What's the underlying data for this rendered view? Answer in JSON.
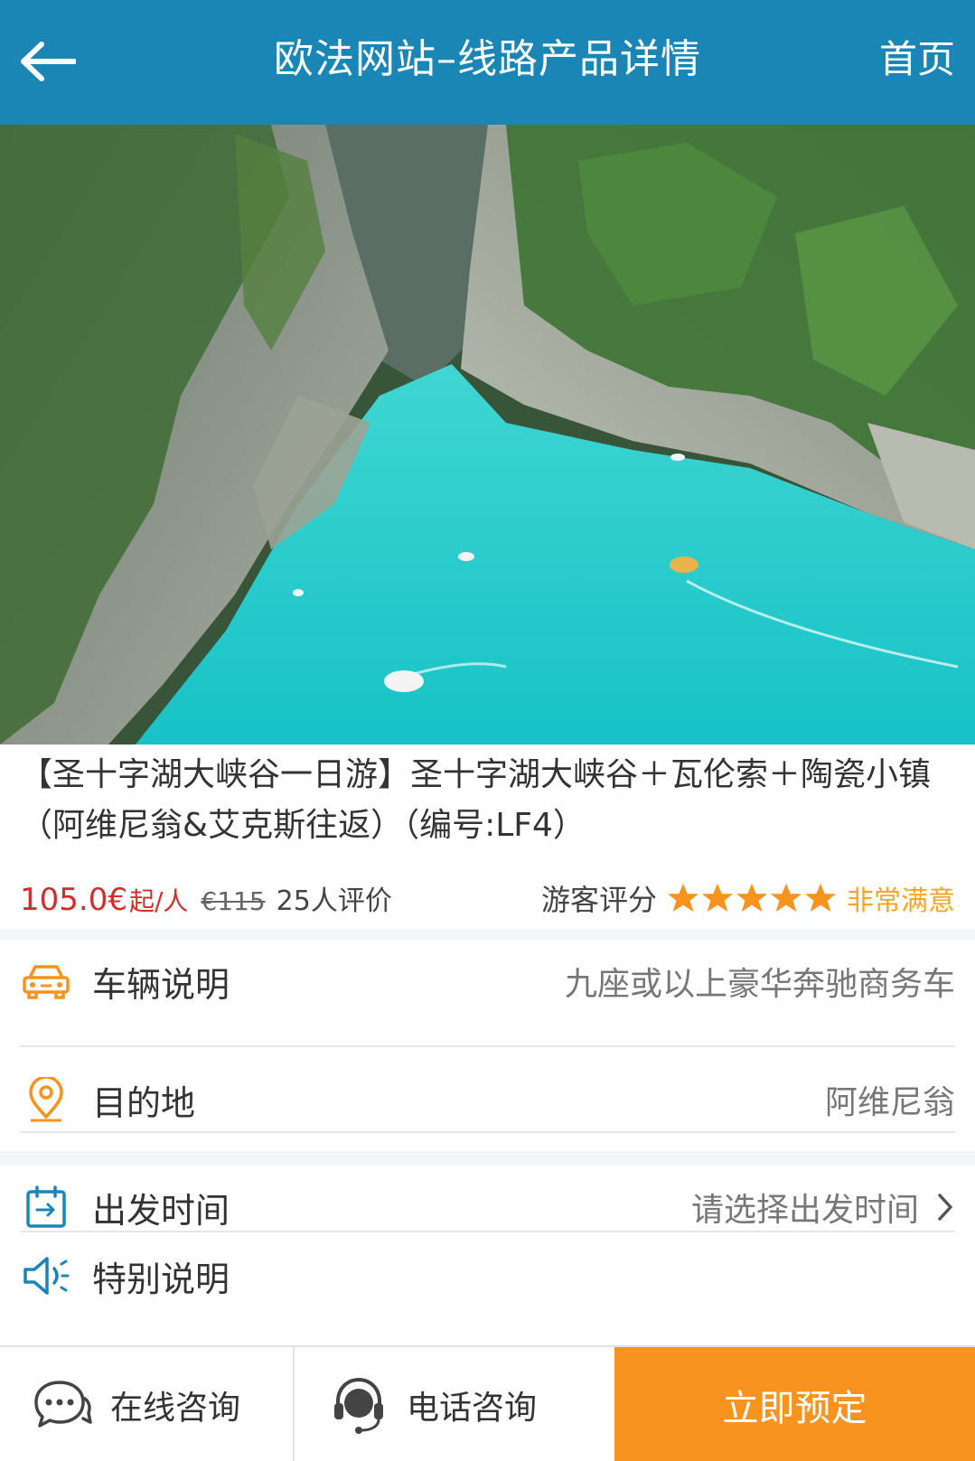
{
  "header": {
    "title": "欧法网站–线路产品详情",
    "home_label": "首页"
  },
  "product": {
    "title": "【圣十字湖大峡谷一日游】圣十字湖大峡谷＋瓦伦索＋陶瓷小镇（阿维尼翁&艾克斯往返）（编号:LF4）",
    "price": "105.0€",
    "price_unit": "起/人",
    "old_price": "€115",
    "review_count": "25人评价",
    "rating_label": "游客评分",
    "rating_stars": 5,
    "rating_text": "非常满意"
  },
  "info": {
    "vehicle": {
      "label": "车辆说明",
      "value": "九座或以上豪华奔驰商务车",
      "icon": "car-icon"
    },
    "destination": {
      "label": "目的地",
      "value": "阿维尼翁",
      "icon": "location-pin-icon"
    }
  },
  "options": {
    "departure": {
      "label": "出发时间",
      "value": "请选择出发时间",
      "icon": "calendar-icon"
    },
    "notes": {
      "label": "特别说明",
      "icon": "speaker-icon"
    }
  },
  "bottom_bar": {
    "online_label": "在线咨询",
    "phone_label": "电话咨询",
    "book_label": "立即预定"
  },
  "colors": {
    "header_bg": "#1a86b6",
    "accent_orange": "#f7931e",
    "price_red": "#d42b2b",
    "icon_blue": "#1a86b6"
  }
}
